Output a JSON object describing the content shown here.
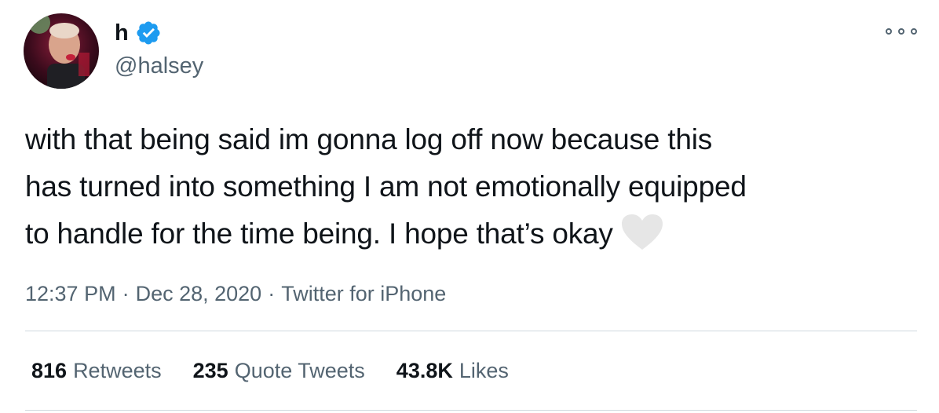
{
  "author": {
    "display_name": "h",
    "handle": "@halsey",
    "verified": true,
    "avatar": "profile-photo"
  },
  "menu_icon": "more-options-icon",
  "tweet": {
    "lines": [
      "with that being said im gonna log off now because this",
      "has turned into something I am not emotionally equipped",
      "to handle for the time being. I hope that’s okay"
    ],
    "emoji": "white-heart-emoji"
  },
  "meta": {
    "time": "12:37 PM",
    "separator": "·",
    "date": "Dec 28, 2020",
    "source": "Twitter for iPhone"
  },
  "stats": {
    "retweets": {
      "count": "816",
      "label": "Retweets"
    },
    "quotes": {
      "count": "235",
      "label": "Quote Tweets"
    },
    "likes": {
      "count": "43.8K",
      "label": "Likes"
    }
  },
  "colors": {
    "text": "#0f1419",
    "secondary": "#536471",
    "verified": "#1d9bf0",
    "divider": "#cfd9de"
  }
}
